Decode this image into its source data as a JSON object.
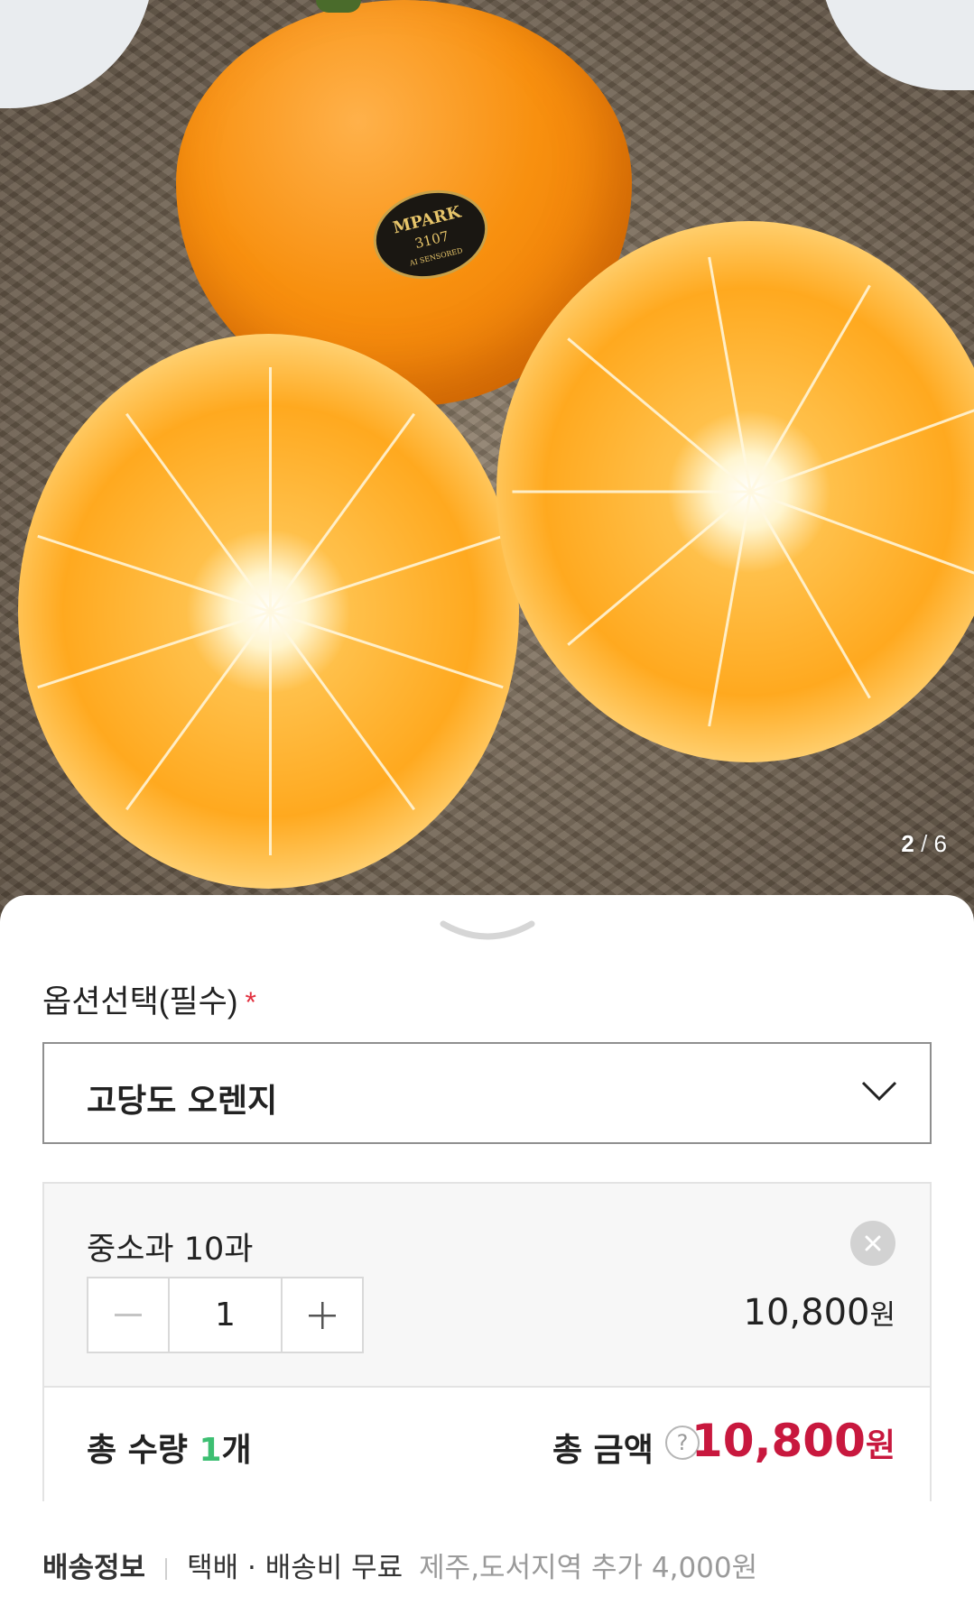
{
  "gallery": {
    "current": "2",
    "separator": "/",
    "total": "6",
    "sticker": {
      "brand": "MPARK",
      "code": "3107",
      "line": "AI SENSORED"
    }
  },
  "option": {
    "label": "옵션선택(필수)",
    "required_mark": "*",
    "selected_value": "고당도 오렌지"
  },
  "cart_item": {
    "name": "중소과 10과",
    "quantity": "1",
    "price": "10,800",
    "price_unit": "원"
  },
  "totals": {
    "quantity_prefix": "총 수량 ",
    "quantity_value": "1",
    "quantity_suffix": "개",
    "amount_label": "총 금액",
    "help_icon": "?",
    "amount_value": "10,800",
    "amount_unit": "원"
  },
  "shipping": {
    "title": "배송정보",
    "method": "택배 · 배송비 무료",
    "extra": "제주,도서지역 추가 4,000원"
  },
  "colors": {
    "accent_total": "#c8183e",
    "quantity_highlight": "#3dbf72",
    "required_mark": "#e2303f"
  }
}
